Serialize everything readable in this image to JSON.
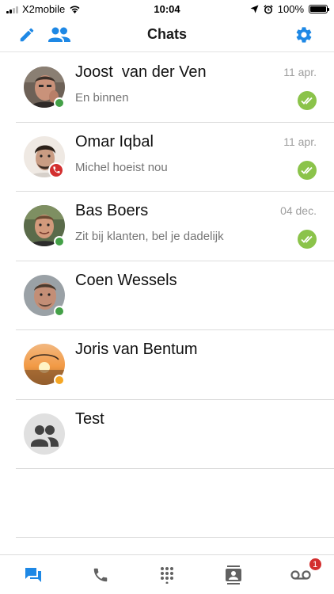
{
  "status_bar": {
    "carrier": "X2mobile",
    "time": "10:04",
    "battery": "100%"
  },
  "header": {
    "title": "Chats",
    "compose_icon": "pencil-icon",
    "groups_icon": "people-icon",
    "settings_icon": "gear-icon",
    "accent_color": "#1e88e5"
  },
  "chats": [
    {
      "name": "Joost  van der Ven",
      "date": "11 apr.",
      "preview": "En binnen",
      "status": "online",
      "read": true
    },
    {
      "name": "Omar Iqbal",
      "date": "11 apr.",
      "preview": "Michel hoeist nou",
      "status": "on-call",
      "read": true
    },
    {
      "name": "Bas Boers",
      "date": "04 dec.",
      "preview": "Zit bij klanten, bel je dadelijk",
      "status": "online",
      "read": true
    },
    {
      "name": "Coen Wessels",
      "date": "",
      "preview": "",
      "status": "online",
      "read": false
    },
    {
      "name": "Joris van Bentum",
      "date": "",
      "preview": "",
      "status": "away",
      "read": false
    },
    {
      "name": "Test",
      "date": "",
      "preview": "",
      "status": "group",
      "read": false
    }
  ],
  "status_colors": {
    "online": "#43a047",
    "away": "#f5a623",
    "on-call": "#d32f2f",
    "read": "#8bc34a"
  },
  "tabs": {
    "items": [
      "chats-icon",
      "phone-icon",
      "dialpad-icon",
      "contacts-icon",
      "voicemail-icon"
    ],
    "active": "chats-icon",
    "voicemail_badge": "1",
    "active_color": "#1e88e5",
    "inactive_color": "#616161"
  }
}
